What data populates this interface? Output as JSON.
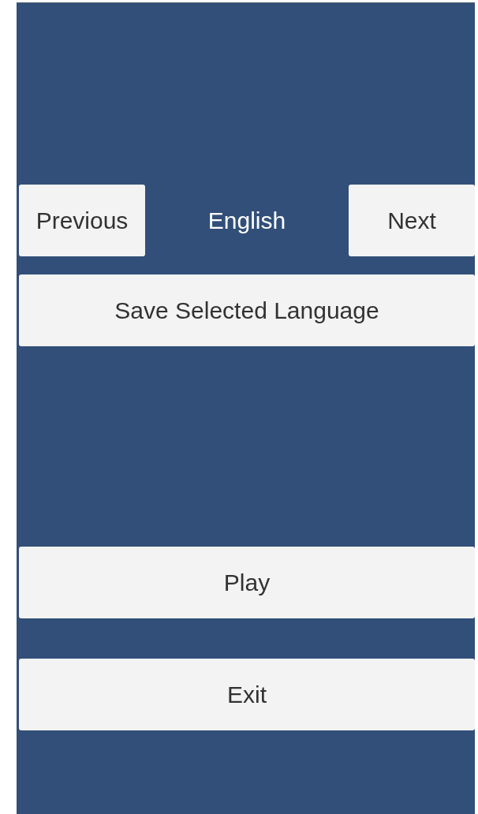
{
  "language_selector": {
    "previous_button": "Previous",
    "current_language": "English",
    "next_button": "Next"
  },
  "save_button": "Save Selected Language",
  "menu_buttons": [
    "Play",
    "Exit"
  ]
}
